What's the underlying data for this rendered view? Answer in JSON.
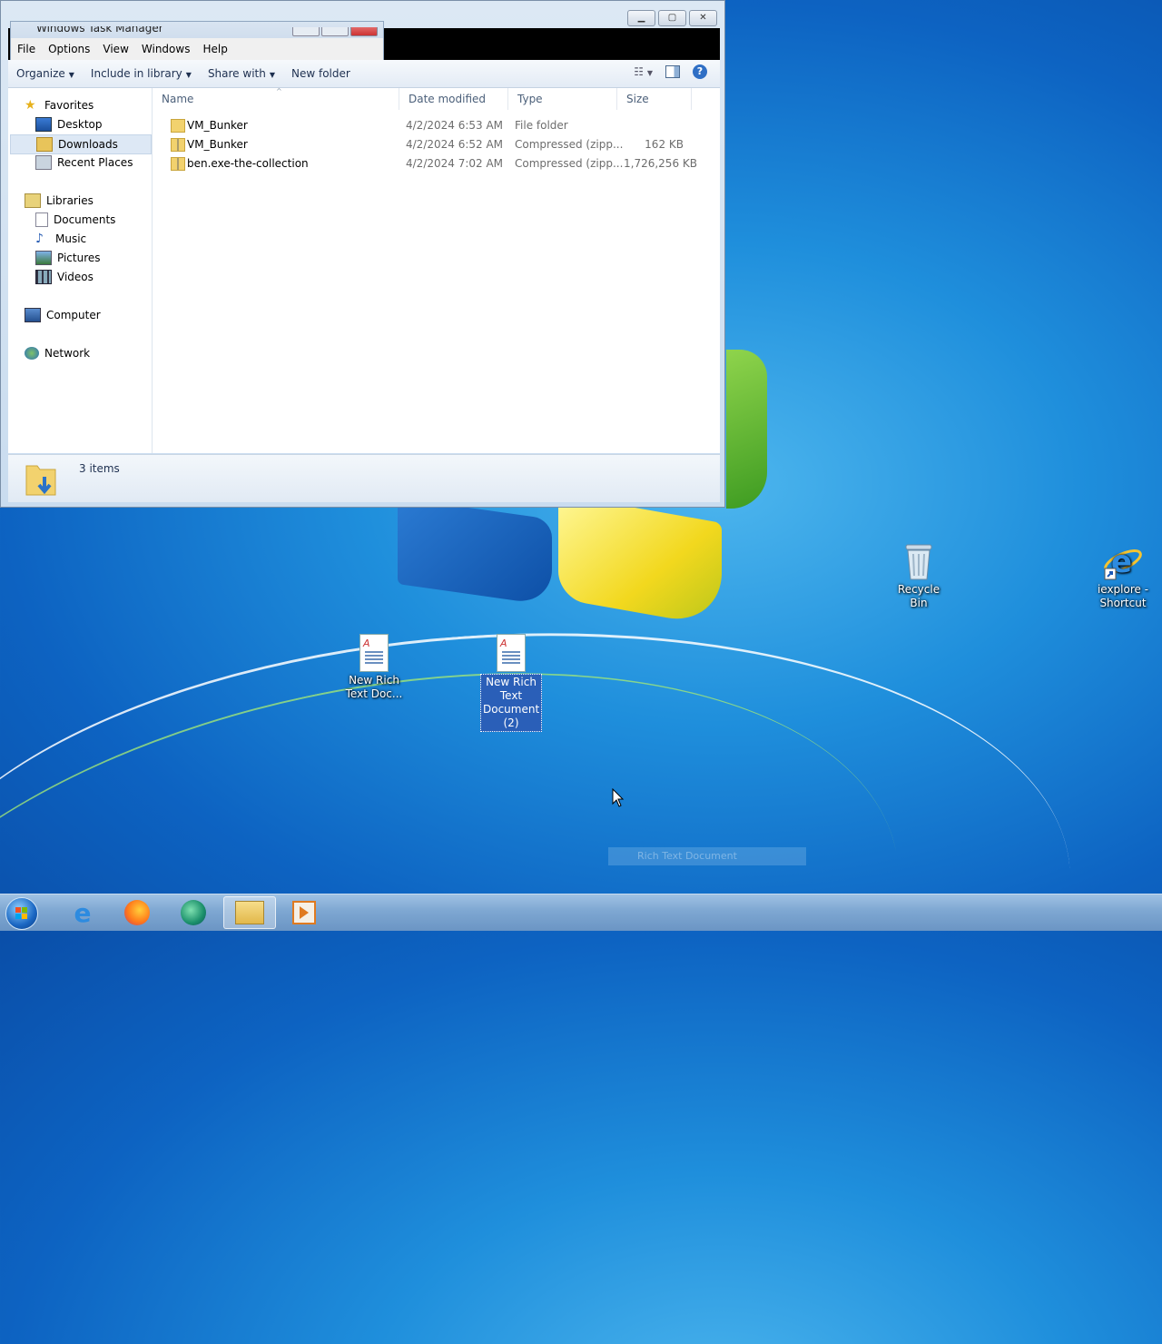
{
  "task_manager": {
    "title": "Windows Task Manager",
    "menu": [
      "File",
      "Options",
      "View",
      "Windows",
      "Help"
    ]
  },
  "explorer": {
    "toolbar": {
      "organize": "Organize",
      "include_in_library": "Include in library",
      "share_with": "Share with",
      "new_folder": "New folder"
    },
    "nav": {
      "favorites": "Favorites",
      "desktop": "Desktop",
      "downloads": "Downloads",
      "recent_places": "Recent Places",
      "libraries": "Libraries",
      "documents": "Documents",
      "music": "Music",
      "pictures": "Pictures",
      "videos": "Videos",
      "computer": "Computer",
      "network": "Network"
    },
    "columns": [
      "Name",
      "Date modified",
      "Type",
      "Size"
    ],
    "files": [
      {
        "name": "VM_Bunker",
        "date": "4/2/2024 6:53 AM",
        "type": "File folder",
        "size": ""
      },
      {
        "name": "VM_Bunker",
        "date": "4/2/2024 6:52 AM",
        "type": "Compressed (zipp...",
        "size": "162 KB"
      },
      {
        "name": "ben.exe-the-collection",
        "date": "4/2/2024 7:02 AM",
        "type": "Compressed (zipp...",
        "size": "1,726,256 KB"
      }
    ],
    "status": "3 items"
  },
  "desktop": {
    "icons": {
      "rtf1": "New Rich Text Doc...",
      "rtf2": "New Rich Text Document (2)",
      "recycle": "Recycle Bin",
      "iexplore": "iexplore - Shortcut"
    },
    "tooltip": "Rich Text Document"
  },
  "colors": {
    "desktop_blue": "#1f8fdc",
    "selection": "#2a5fb8",
    "taskbar": "#7ea7d2"
  }
}
